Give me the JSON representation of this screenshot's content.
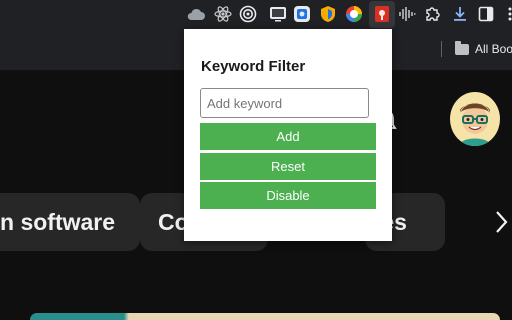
{
  "toolbar": {
    "icons": [
      "cloud-extension-icon",
      "react-devtools-icon",
      "target-extension-icon",
      "screen-extension-icon",
      "shield-extension-icon",
      "color-extension-icon",
      "keyword-filter-extension-icon",
      "audio-wave-icon",
      "puzzle-extensions-icon",
      "download-icon",
      "side-panel-icon",
      "more-icon"
    ]
  },
  "bookmarks": {
    "all_bookmarks_label": "All Bookm"
  },
  "page": {
    "chips": [
      "n software",
      "Co",
      "ies"
    ]
  },
  "popup": {
    "title": "Keyword Filter",
    "input_placeholder": "Add keyword",
    "add_label": "Add",
    "reset_label": "Reset",
    "disable_label": "Disable"
  },
  "colors": {
    "button_green": "#4caf50",
    "page_bg": "#0f0f0f",
    "chrome_bg": "#202124"
  }
}
